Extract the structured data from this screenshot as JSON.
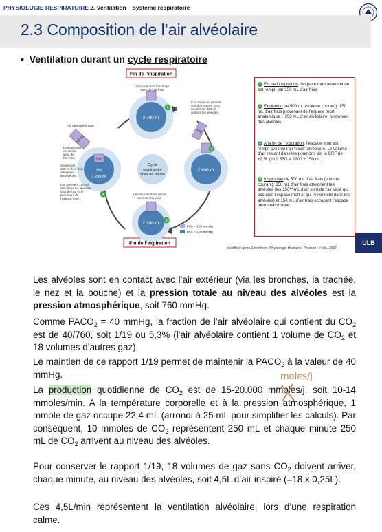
{
  "slide": {
    "breadcrumb_main": "PHYSIOLOGIE RESPIRATOIRE",
    "breadcrumb_sub": "2. Ventilation – système respiratoire",
    "title": "2.3 Composition de l’air alvéolaire",
    "bullet_prefix": "Ventilation durant un ",
    "bullet_underlined": "cycle respiratoire",
    "badge": "ULB",
    "credit": "Modifié d’après Silverthorn, Physiologie Humaine, Pearson, 4ᵉ éd., 2007"
  },
  "diagram": {
    "fin_inspiration": "Fin de l’inspiration",
    "fin_expiration": "Fin de l’expiration",
    "center_line1": "Cycle",
    "center_line2": "respiratoire",
    "center_line3": "chez un adulte",
    "vol_top": "2 700 ml",
    "vol_right": "2 800 ml",
    "vol_bottom": "2 200 ml",
    "vol_left": "2 200 ml",
    "vol_150a": "150",
    "vol_150b": "150",
    "vol_350": "350",
    "vol_500": "500 ml",
    "air_atmo": "Air atmosphérique",
    "note_top_left_1": "L’espace mort est rempli",
    "note_top_left_2": "avec de l’air frais.",
    "note_top_right_1": "L’air expiré en premier",
    "note_top_right_2": "sort de l’espace mort.",
    "note_top_right_3": "Seulement 350 ml",
    "note_top_right_4": "quittent les alvéoles.",
    "note_left_1": "L’espace mort",
    "note_left_2": "est rempli",
    "note_left_3": "avec de",
    "note_left_4": "l’air frais",
    "note_left_5": "Seulement",
    "note_left_6": "350 ml d’air frais",
    "note_left_7": "atteignent",
    "note_left_8": "les alvéoles",
    "note_left_9": "Les premiers 150 ml",
    "note_left_10": "d’air dans les alvéoles",
    "note_left_11": "sont de l’air vicié",
    "note_left_12": "provenant de",
    "note_left_13": "l’espace mort.",
    "note_bottom_1": "L’espace mort est rempli",
    "note_bottom_2": "avec de l’air vicié.",
    "legend_po2_high": "PO₂ = 150 mmHg",
    "legend_po2_low": "PO₂ = 100 mmHg",
    "step1": "1",
    "step2": "2",
    "step3": "3",
    "step4": "4"
  },
  "info_box": [
    {
      "num": "1",
      "label": "Fin de l’inspiration",
      "text": ": l’espace mort anatomique est rempli par 150 mL d’air frais"
    },
    {
      "num": "2",
      "label": "Expiration",
      "text": " de 500 mL (volume courant): 150 mL d’air frais provenant de l’espace mort anatomique + 350 mL d’air alvéolaire, provenant des alvéoles"
    },
    {
      "num": "3",
      "label": "A la fin de l’expiration",
      "text": ", l’espace mort est rempli avec de l’air “vicié” alvéolaire. Le volume d’air restant dans les poumons est la CRF de ±2,5L (ici 2,350L= 2200 + 150 mL)"
    },
    {
      "num": "4",
      "label": "Inspiration",
      "text": " de 500 mL d’air frais (volume courant): 350 mL d’air frais atteignent les alvéoles (les 150** mL d’air sont de l’air vicié qui occupait l’espace mort et qui reviennent dans les alvéoles) et 150 mL d’air frais occupent l’espace mort anatomique"
    }
  ],
  "body": {
    "p1_a": "Les alvéoles sont en contact avec l’air extérieur (via les bronches, la trachée, le nez et la bouche) et la ",
    "p1_b": "pression totale au niveau des alvéoles",
    "p1_c": " est la ",
    "p1_d": "pression atmosphérique",
    "p1_e": ", soit 760 mmHg.",
    "p2_a": "Comme PACO",
    "p2_b": " = 40 mmHg, la fraction de l’air alvéolaire qui contient du CO",
    "p2_c": " est de 40/760, soit 1/19 ou 5,3% (l’air alvéolaire contient 1 volume de CO",
    "p2_d": " et 18 volumes d’autres gaz).",
    "p3_a": "Le maintien de ce rapport 1/19 permet de maintenir la PACO",
    "p3_b": " à la valeur de 40 mmHg.",
    "p4_a": "La ",
    "p4_hl": "production",
    "p4_b": " quotidienne de CO",
    "p4_c": " est de 15-20.000 mmoles/j, soit 10-14 mmoles/min. A la température corporelle et à la pression atmosphérique, 1 mmole de gaz occupe 22,4 mL (arrondi à 25 mL pour simplifier les calculs). Par conséquent, 10 mmoles de CO",
    "p4_d": " représentent 250 mL et chaque minute 250 mL de CO",
    "p4_e": " arrivent au niveau des alvéoles.",
    "p5_a": "Pour conserver le rapport 1/19, 18 volumes de gaz sans CO",
    "p5_b": " doivent arriver, chaque minute, au niveau des alvéoles, soit 4,5L d’air inspiré (=18 x 0,25L).",
    "p6": "Ces 4,5L/min représentent la ventilation alvéolaire, lors d’une respiration calme.",
    "sub2": "2",
    "annotation": "moles/j"
  }
}
